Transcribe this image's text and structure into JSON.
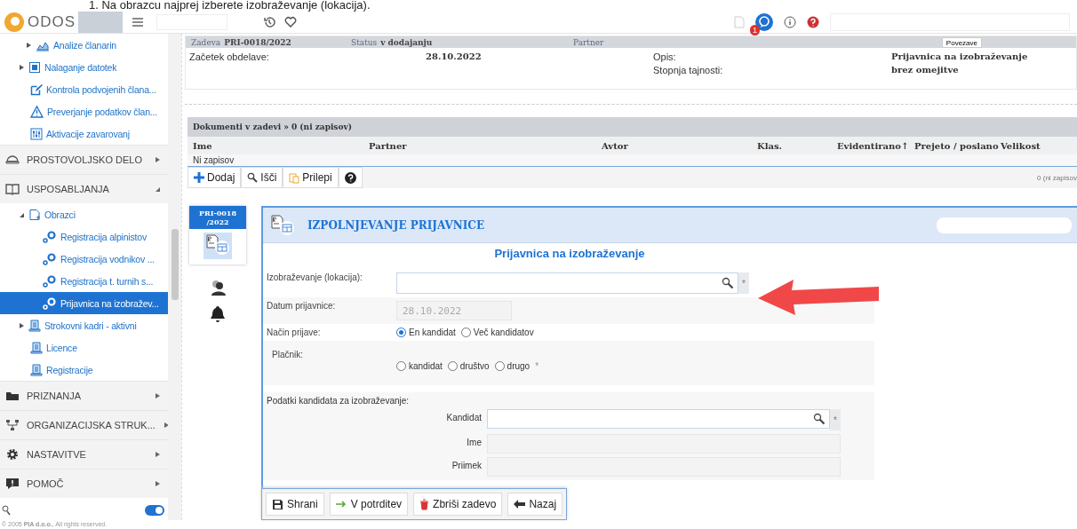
{
  "caption": "1.    Na obrazcu najprej izberete izobraževanje (lokacija).",
  "topbar": {
    "brand": "ODOS",
    "badge": "1"
  },
  "sidebar": {
    "items": [
      {
        "kind": "link",
        "label": "Analize članarin",
        "expanded": false,
        "selected": false
      },
      {
        "kind": "link",
        "label": "Nalaganje datotek",
        "expanded": false,
        "selected": false
      },
      {
        "kind": "link",
        "label": "Kontrola podvojenih člana...",
        "selected": false
      },
      {
        "kind": "link",
        "label": "Preverjanje podatkov član...",
        "selected": false
      },
      {
        "kind": "link",
        "label": "Aktivacije zavarovanj",
        "selected": false
      },
      {
        "kind": "section",
        "label": "PROSTOVOLJSKO DELO",
        "expanded": false
      },
      {
        "kind": "section",
        "label": "USPOSABLJANJA",
        "expanded": true,
        "children": [
          {
            "kind": "link",
            "label": "Obrazci",
            "expanded": true,
            "selected": false,
            "children": [
              {
                "kind": "link",
                "label": "Registracija alpinistov",
                "selected": false
              },
              {
                "kind": "link",
                "label": "Registracija vodnikov ...",
                "selected": false
              },
              {
                "kind": "link",
                "label": "Registracija t. turnih s...",
                "selected": false
              },
              {
                "kind": "link",
                "label": "Prijavnica na izobražev...",
                "selected": true
              }
            ]
          },
          {
            "kind": "link",
            "label": "Strokovni kadri - aktivni",
            "expanded": false,
            "selected": false
          },
          {
            "kind": "link",
            "label": "Licence",
            "selected": false
          },
          {
            "kind": "link",
            "label": "Registracije",
            "selected": false
          }
        ]
      },
      {
        "kind": "section",
        "label": "PRIZNANJA",
        "expanded": false
      },
      {
        "kind": "section",
        "label": "ORGANIZACIJSKA STRUK...",
        "expanded": false
      },
      {
        "kind": "section",
        "label": "NASTAVITVE",
        "expanded": false
      },
      {
        "kind": "section",
        "label": "POMOČ",
        "expanded": false
      }
    ],
    "toggle_on": true
  },
  "case": {
    "fields": [
      {
        "label": "Zadeva",
        "value": "PRI-0018/2022"
      },
      {
        "label": "Status",
        "value": "v dodajanju"
      },
      {
        "label": "Partner"
      }
    ],
    "links_button": "Povezave",
    "details": [
      {
        "label": "Začetek obdelave:",
        "value": "28.10.2022"
      },
      {
        "label": "Opis:",
        "value": "Prijavnica na izobraževanje"
      },
      {
        "label": "Stopnja tajnosti:",
        "value": "brez omejitve"
      }
    ]
  },
  "documents": {
    "title": "Dokumenti v zadevi » 0 (ni zapisov)",
    "columns": [
      "Ime",
      "Partner",
      "Avtor",
      "Klas.",
      "Evidentirano↑",
      "Prejeto / poslano",
      "Velikost"
    ],
    "empty": "Ni zapisov",
    "tools": [
      {
        "kind": "add",
        "label": "Dodaj"
      },
      {
        "kind": "search",
        "label": "Išči"
      },
      {
        "kind": "paste",
        "label": "Prilepi"
      },
      {
        "kind": "help"
      }
    ],
    "count": "0 (ni zapisov"
  },
  "case_tab": {
    "label": "PRI-0018 /2022",
    "selected": true
  },
  "form": {
    "header": "IZPOLNJEVANJE PRIJAVNICE",
    "title": "Prijavnica na izobraževanje",
    "fields": [
      {
        "kind": "lookup",
        "label": "Izobraževanje (lokacija):",
        "mark": "*"
      },
      {
        "kind": "text",
        "label": "Datum prijavnice:",
        "value": "28.10.2022",
        "disabled": true
      },
      {
        "kind": "radio",
        "label": "Način prijave:",
        "options": [
          {
            "label": "En kandidat",
            "selected": true
          },
          {
            "label": "Več kandidatov",
            "selected": false
          }
        ]
      },
      {
        "kind": "radio",
        "label": "Plačnik:",
        "mark": "*",
        "options": [
          {
            "label": "kandidat",
            "selected": false
          },
          {
            "label": "društvo",
            "selected": false
          },
          {
            "label": "drugo",
            "selected": false
          }
        ]
      },
      {
        "kind": "group",
        "label": "Podatki kandidata za izobraževanje:",
        "fields": [
          {
            "kind": "lookup",
            "label": "Kandidat",
            "mark": "*"
          },
          {
            "kind": "text",
            "label": "Ime",
            "disabled": true
          },
          {
            "kind": "text",
            "label": "Priimek",
            "disabled": true
          }
        ]
      }
    ],
    "buttons": [
      {
        "kind": "save",
        "label": "Shrani"
      },
      {
        "kind": "forward",
        "label": "V potrditev"
      },
      {
        "kind": "delete",
        "label": "Zbriši zadevo"
      },
      {
        "kind": "back",
        "label": "Nazaj"
      }
    ]
  },
  "footer": "© 2005 **PIA d.o.o.**, All rights reserved."
}
